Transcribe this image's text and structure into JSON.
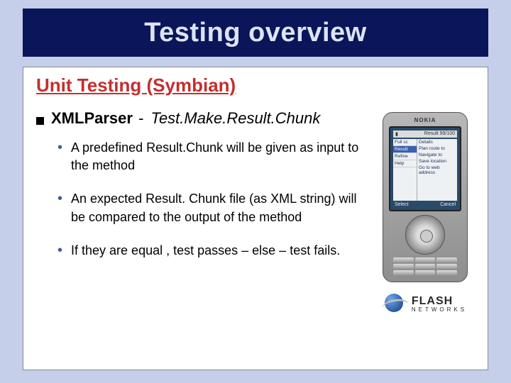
{
  "title": "Testing overview",
  "section_heading": "Unit Testing (Symbian)",
  "main": {
    "bold": "XMLParser",
    "dash": "-",
    "italic": "Test.Make.Result.Chunk"
  },
  "bullets": [
    "A predefined Result.Chunk will be given as input to the method",
    "An expected Result. Chunk file (as XML string) will be compared to the output of the method",
    "If they are equal , test passes – else – test fails."
  ],
  "phone": {
    "brand": "NOKIA",
    "status": "Result 99/100",
    "left_menu": [
      "Full sc",
      "Result",
      "Refine",
      "Help"
    ],
    "right_menu": [
      "Details",
      "Plan route to",
      "Navigate to",
      "Save location",
      "Go to web address"
    ],
    "soft_left": "Select",
    "soft_right": "Cancel"
  },
  "logo": {
    "line1": "FLASH",
    "line2": "NETWORKS"
  }
}
